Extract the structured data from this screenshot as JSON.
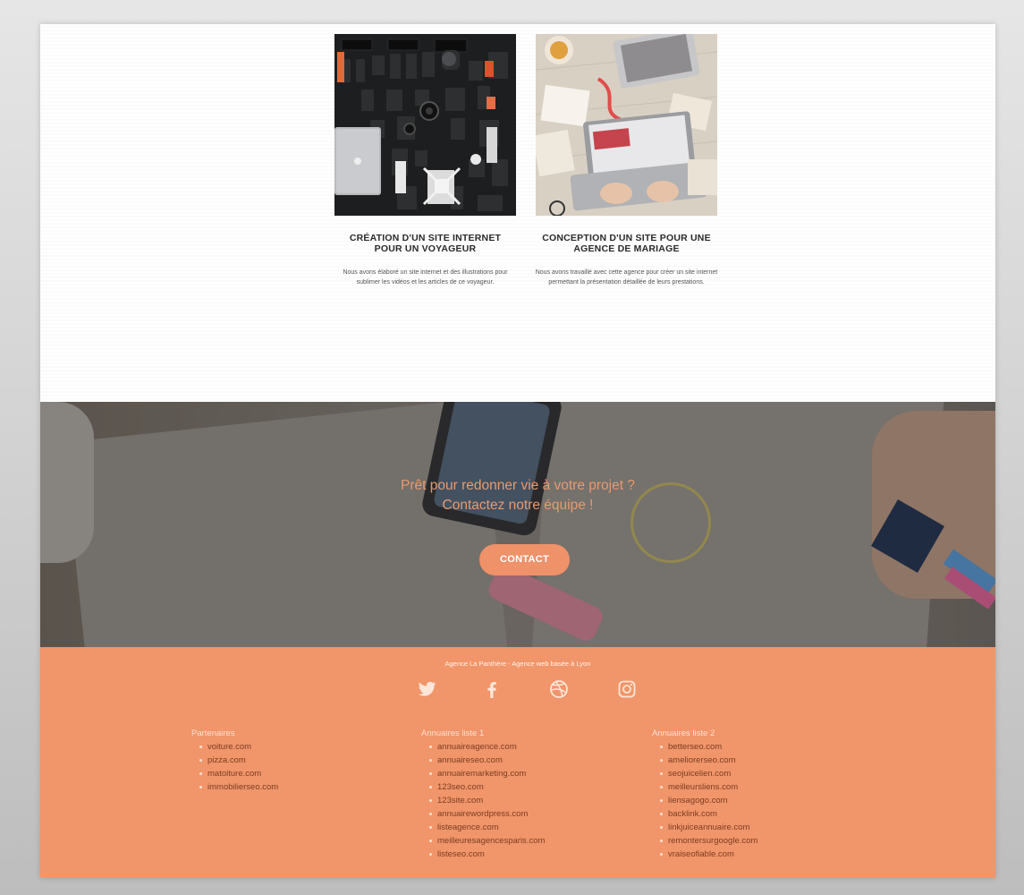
{
  "portfolio": {
    "cards": [
      {
        "title": "CRÉATION D'UN SITE INTERNET POUR UN VOYAGEUR",
        "text": "Nous avons élaboré un site internet et des illustrations pour sublimer les vidéos et les articles de ce voyageur.",
        "image": "camera-gear-flatlay"
      },
      {
        "title": "CONCEPTION D'UN SITE POUR UNE AGENCE DE MARIAGE",
        "text": "Nous avons travaillé avec cette agence pour créer un site internet permettant la présentation détaillée de leurs prestations.",
        "image": "laptop-desk-flatlay"
      }
    ]
  },
  "cta": {
    "line1": "Prêt pour redonner vie à votre projet ?",
    "line2": "Contactez notre équipe !",
    "button": "CONTACT",
    "accent": "#ef9169"
  },
  "footer": {
    "agency": "Agence La Panthère - Agence web basée à Lyon",
    "social": [
      "twitter-icon",
      "facebook-icon",
      "dribbble-icon",
      "instagram-icon"
    ],
    "background": "#f1956a",
    "columns": [
      {
        "heading": "Partenaires",
        "links": [
          "voiture.com",
          "pizza.com",
          "matoiture.com",
          "immobilierseo.com"
        ]
      },
      {
        "heading": "Annuaires liste 1",
        "links": [
          "annuaireagence.com",
          "annuaireseo.com",
          "annuairemarketing.com",
          "123seo.com",
          "123site.com",
          "annuairewordpress.com",
          "listeagence.com",
          "meilleuresagencesparis.com",
          "listeseo.com"
        ]
      },
      {
        "heading": "Annuaires liste 2",
        "links": [
          "betterseo.com",
          "ameliorerseo.com",
          "seojuicelien.com",
          "meilleursliens.com",
          "liensagogo.com",
          "backlink.com",
          "linkjuiceannuaire.com",
          "remontersurgoogle.com",
          "vraiseofiable.com"
        ]
      }
    ]
  }
}
